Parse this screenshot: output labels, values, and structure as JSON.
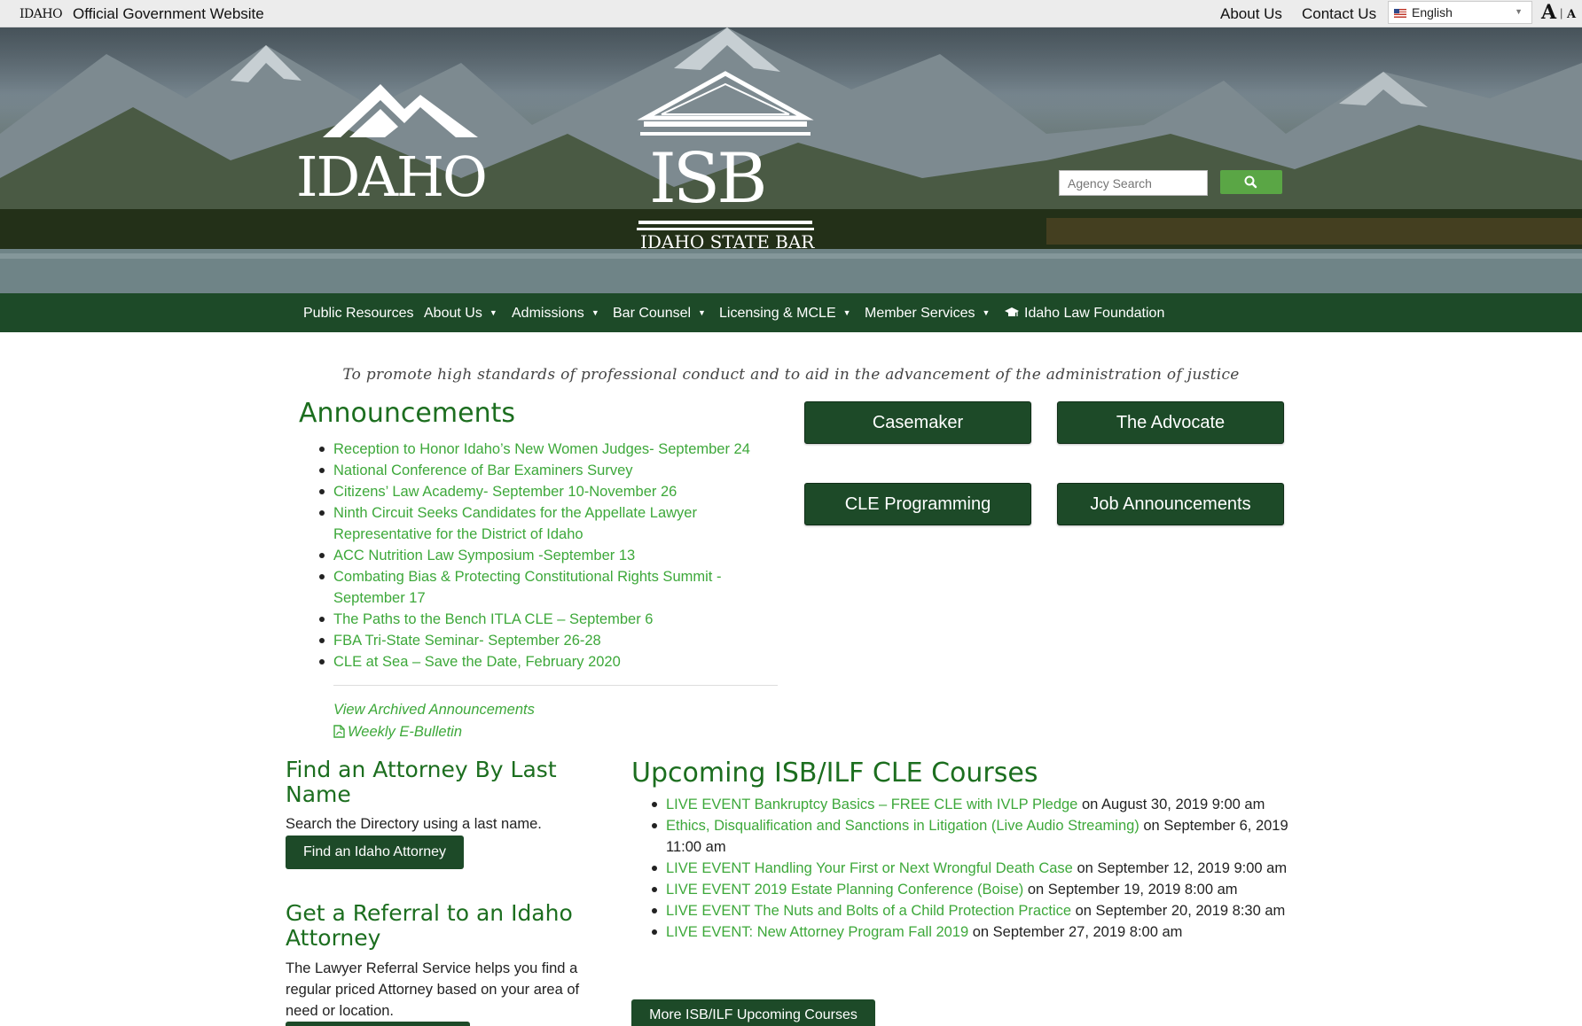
{
  "util_bar": {
    "logo_text": "IDAHO",
    "official_label": "Official Government Website",
    "about_link": "About Us",
    "contact_link": "Contact Us",
    "language": "English",
    "font_larger": "A",
    "font_separator": "|",
    "font_smaller": "A"
  },
  "hero": {
    "idaho_logo_text": "IDAHO",
    "isb_letters": "ISB",
    "isb_subtitle": "IDAHO STATE BAR",
    "search_placeholder": "Agency Search"
  },
  "nav": {
    "items": [
      {
        "label": "Public Resources",
        "dropdown": false
      },
      {
        "label": "About Us",
        "dropdown": true
      },
      {
        "label": "Admissions",
        "dropdown": true
      },
      {
        "label": "Bar Counsel",
        "dropdown": true
      },
      {
        "label": "Licensing & MCLE",
        "dropdown": true
      },
      {
        "label": "Member Services",
        "dropdown": true
      },
      {
        "label": "Idaho Law Foundation",
        "dropdown": false
      }
    ]
  },
  "tagline": "To promote high standards of professional conduct and to aid in the advancement of the administration of justice",
  "announcements": {
    "title": "Announcements",
    "items": [
      "Reception to Honor Idaho’s New Women Judges- September 24",
      "National Conference of Bar Examiners Survey",
      "Citizens’ Law Academy- September 10-November 26",
      "Ninth Circuit Seeks Candidates for the Appellate Lawyer Representative for the District of Idaho",
      "ACC Nutrition Law Symposium -September 13",
      "Combating Bias & Protecting Constitutional Rights Summit - September 17",
      "The Paths to the Bench ITLA CLE – September 6",
      "FBA Tri-State Seminar- September 26-28",
      "CLE at Sea – Save the Date, February 2020"
    ],
    "archived_link": "View Archived Announcements",
    "bulletin_link": "Weekly E-Bulletin"
  },
  "quick_buttons": {
    "casemaker": "Casemaker",
    "advocate": "The Advocate",
    "cle_programming": "CLE Programming",
    "job_announcements": "Job Announcements"
  },
  "find_attorney": {
    "title": "Find an Attorney By Last Name",
    "description": "Search the Directory using a last name.",
    "button": "Find an Idaho Attorney"
  },
  "referral": {
    "title": "Get a Referral to an Idaho Attorney",
    "description": "The Lawyer Referral Service helps you find a regular priced Attorney based on your area of need or location."
  },
  "cle_courses": {
    "title": "Upcoming ISB/ILF CLE Courses",
    "items": [
      {
        "link": "LIVE EVENT Bankruptcy Basics – FREE CLE with IVLP Pledge",
        "date": " on August 30, 2019 9:00 am"
      },
      {
        "link": "Ethics, Disqualification and Sanctions in Litigation (Live Audio Streaming)",
        "date": " on September 6, 2019 11:00 am"
      },
      {
        "link": "LIVE EVENT Handling Your First or Next Wrongful Death Case",
        "date": " on September 12, 2019 9:00 am"
      },
      {
        "link": "LIVE EVENT 2019 Estate Planning Conference (Boise)",
        "date": " on September 19, 2019 8:00 am"
      },
      {
        "link": "LIVE EVENT The Nuts and Bolts of a Child Protection Practice",
        "date": " on September 20, 2019 8:30 am"
      },
      {
        "link": "LIVE EVENT: New Attorney Program Fall 2019",
        "date": " on September 27, 2019 8:00 am"
      }
    ],
    "more_button": "More ISB/ILF Upcoming Courses"
  },
  "colors": {
    "nav_green": "#1d4a28",
    "link_green": "#3da83a",
    "heading_green": "#1c6e1f",
    "search_button": "#5aa645"
  },
  "icons": [
    "us-flag-icon",
    "search-icon",
    "mortarboard-icon",
    "pdf-icon",
    "caret-down-icon"
  ]
}
